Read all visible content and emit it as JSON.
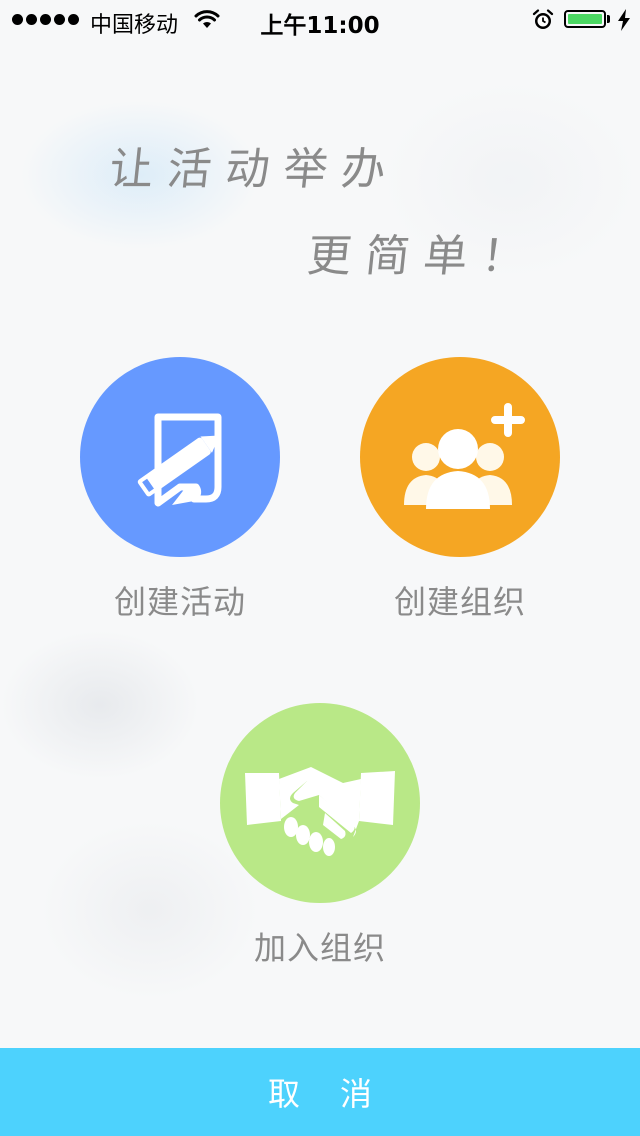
{
  "status_bar": {
    "carrier": "中国移动",
    "time": "上午11:00",
    "battery_level": 1.0
  },
  "slogan": {
    "line1": "让活动举办",
    "line2": "更简单！"
  },
  "actions": [
    {
      "label": "创建活动",
      "icon": "edit-note-icon",
      "color": "#6699ff"
    },
    {
      "label": "创建组织",
      "icon": "add-group-icon",
      "color": "#f5a623"
    },
    {
      "label": "加入组织",
      "icon": "handshake-icon",
      "color": "#b9e887"
    }
  ],
  "cancel_label": "取消",
  "colors": {
    "accent": "#4dd2fd",
    "text_gray": "#8a8a8a"
  }
}
